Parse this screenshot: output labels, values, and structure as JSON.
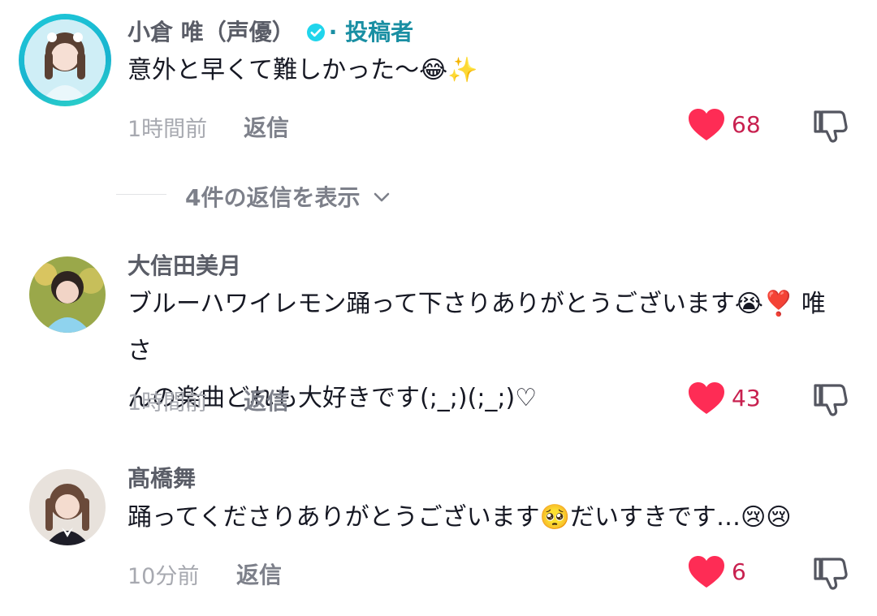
{
  "comments": [
    {
      "username": "小倉 唯（声優）",
      "author_label": "· 投稿者",
      "verified": true,
      "text": "意外と早くて難しかった〜😂✨",
      "time": "1時間前",
      "reply_label": "返信",
      "likes": "68",
      "liked": true
    },
    {
      "username": "大信田美月",
      "text_line1": "ブルーハワイレモン踊って下さりありがとうございます😭❣️ 唯さ",
      "text_line2": "んの楽曲どれも大好きです(;_;)(;_;)♡",
      "time": "1時間前",
      "reply_label": "返信",
      "likes": "43",
      "liked": true
    },
    {
      "username": "髙橋舞",
      "text": "踊ってくださりありがとうございます🥺だいすきです…😢😢",
      "time": "10分前",
      "reply_label": "返信",
      "likes": "6",
      "liked": true
    }
  ],
  "view_replies": "4件の返信を表示",
  "colors": {
    "like_red": "#fe2c55",
    "author_teal": "#1a8fa3",
    "verified_teal": "#20d5ec"
  },
  "icons": [
    "verified-badge-icon",
    "heart-icon",
    "dislike-icon",
    "chevron-down-icon"
  ]
}
